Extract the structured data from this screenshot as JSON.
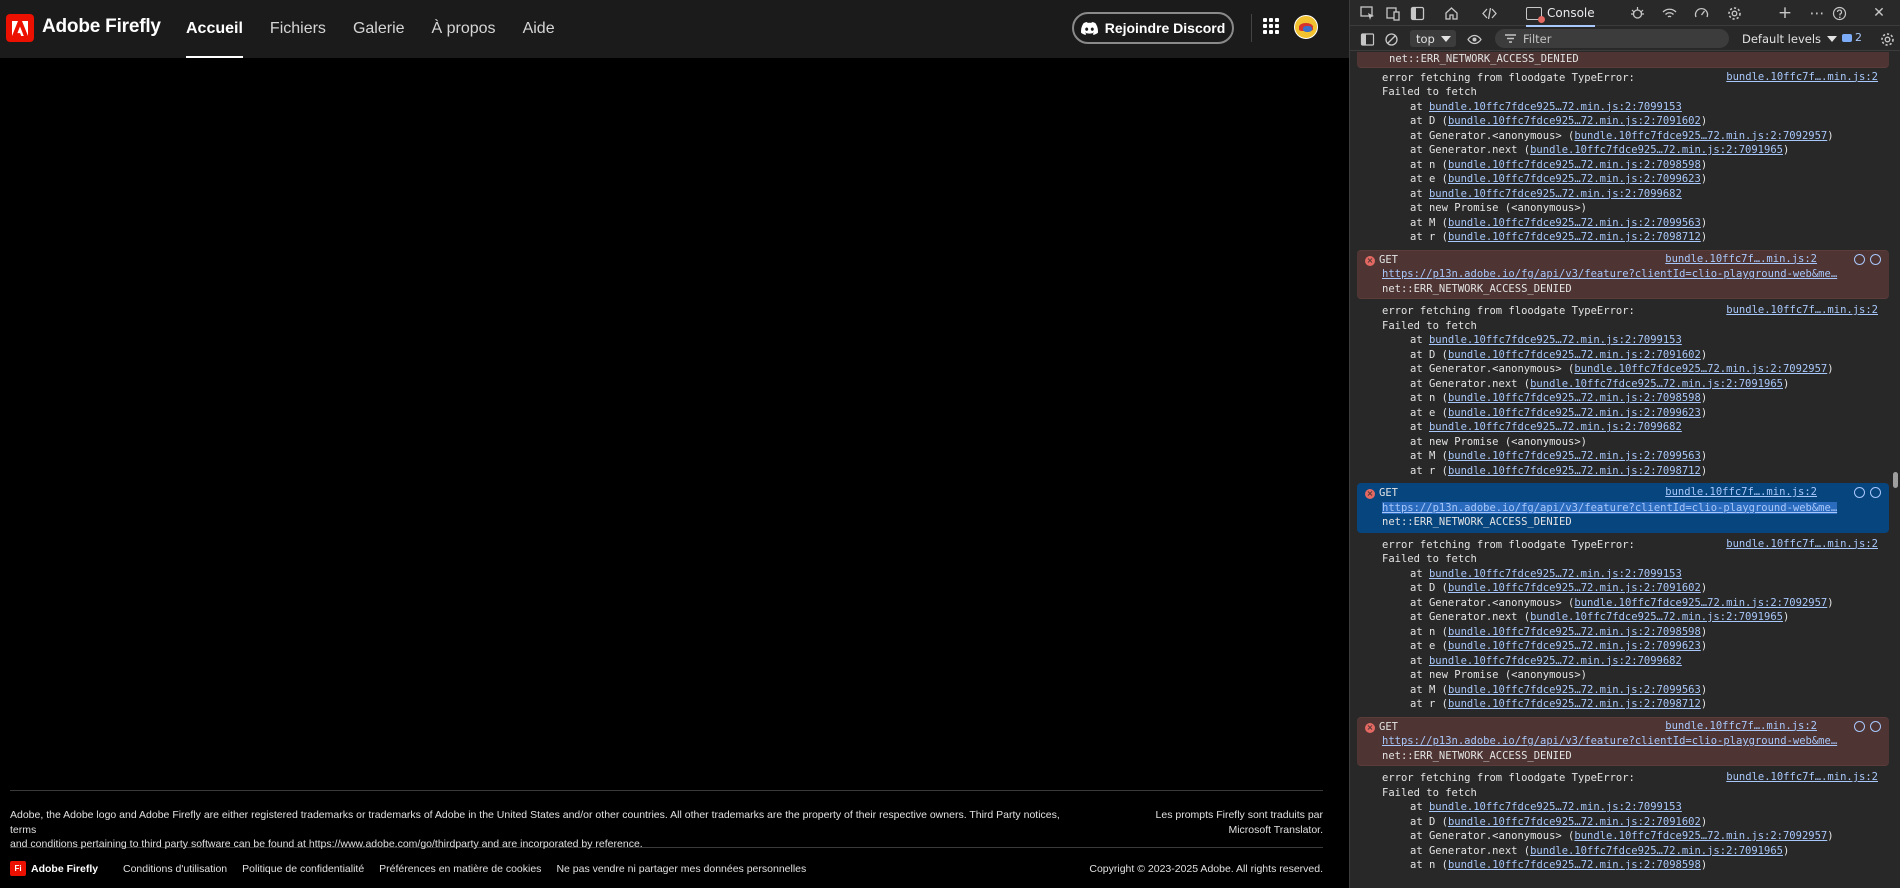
{
  "site": {
    "brand": "Adobe Firefly",
    "nav": [
      "Accueil",
      "Fichiers",
      "Galerie",
      "À propos",
      "Aide"
    ],
    "discord_label": "Rejoindre Discord",
    "footer": {
      "legal_line1": "Adobe, the Adobe logo and Adobe Firefly are either registered trademarks or trademarks of Adobe in the United States and/or other countries. All other trademarks are the property of their respective owners. Third Party notices, terms",
      "legal_line2": "and conditions pertaining to third party software can be found at https://www.adobe.com/go/thirdparty and are incorporated by reference.",
      "translate_line1": "Les prompts Firefly sont traduits par",
      "translate_line2": "Microsoft Translator.",
      "logo_text": "Fi",
      "brand": "Adobe Firefly",
      "links": [
        "Conditions d'utilisation",
        "Politique de confidentialité",
        "Préférences en matière de cookies",
        "Ne pas vendre ni partager mes données personnelles"
      ],
      "copyright": "Copyright © 2023-2025 Adobe. All rights reserved."
    }
  },
  "devtools": {
    "console_tab": "Console",
    "context": "top",
    "filter_placeholder": "Filter",
    "levels": "Default levels",
    "issues_count": "2",
    "top_partial": "net::ERR_NETWORK_ACCESS_DENIED",
    "log": {
      "line1": "error fetching from floodgate TypeError:",
      "line2": "Failed to fetch",
      "source": "bundle.10ffc7f….min.js:2",
      "stack": [
        {
          "pre": "at ",
          "link": "bundle.10ffc7fdce925…72.min.js:2:7099153",
          "post": ""
        },
        {
          "pre": "at D (",
          "link": "bundle.10ffc7fdce925…72.min.js:2:7091602",
          "post": ")"
        },
        {
          "pre": "at Generator.<anonymous> (",
          "link": "bundle.10ffc7fdce925…72.min.js:2:7092957",
          "post": ")"
        },
        {
          "pre": "at Generator.next (",
          "link": "bundle.10ffc7fdce925…72.min.js:2:7091965",
          "post": ")"
        },
        {
          "pre": "at n (",
          "link": "bundle.10ffc7fdce925…72.min.js:2:7098598",
          "post": ")"
        },
        {
          "pre": "at e (",
          "link": "bundle.10ffc7fdce925…72.min.js:2:7099623",
          "post": ")"
        },
        {
          "pre": "at ",
          "link": "bundle.10ffc7fdce925…72.min.js:2:7099682",
          "post": ""
        },
        {
          "pre": "at new Promise (<anonymous>)",
          "link": "",
          "post": ""
        },
        {
          "pre": "at M (",
          "link": "bundle.10ffc7fdce925…72.min.js:2:7099563",
          "post": ")"
        },
        {
          "pre": "at r (",
          "link": "bundle.10ffc7fdce925…72.min.js:2:7098712",
          "post": ")"
        }
      ]
    },
    "get": {
      "method": "GET",
      "source": "bundle.10ffc7f….min.js:2",
      "url": "https://p13n.adobe.io/fg/api/v3/feature?clientId=clio-playground-web&me…",
      "error": "net::ERR_NETWORK_ACCESS_DENIED"
    },
    "blocks": [
      "log",
      "get",
      "log",
      "get-selected",
      "log",
      "get",
      "log-partial"
    ],
    "icons": [
      "inspect-icon",
      "device-toolbar-icon",
      "sidebar-toggle-icon",
      "home-icon",
      "elements-icon",
      "console-icon",
      "sources-icon",
      "network-icon",
      "performance-icon",
      "settings-icon",
      "add-tab-icon",
      "more-icon",
      "help-icon",
      "close-icon"
    ]
  }
}
